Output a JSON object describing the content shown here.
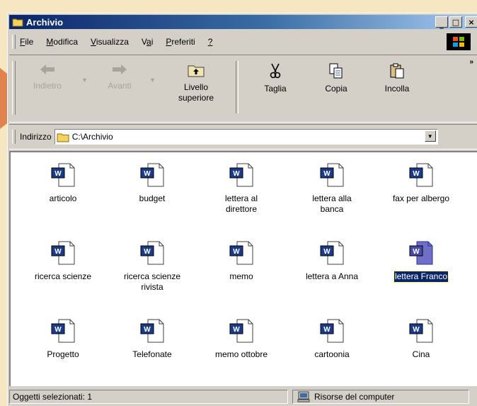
{
  "window": {
    "title": "Archivio"
  },
  "menu": [
    {
      "id": "file",
      "label": "File",
      "u": "F",
      "rest": "ile"
    },
    {
      "id": "modifica",
      "label": "Modifica",
      "u": "M",
      "rest": "odifica"
    },
    {
      "id": "visualizza",
      "label": "Visualizza",
      "u": "V",
      "rest": "isualizza"
    },
    {
      "id": "vai",
      "label": "Vai",
      "pre": "V",
      "u": "a",
      "rest": "i"
    },
    {
      "id": "preferiti",
      "label": "Preferiti",
      "u": "P",
      "rest": "referiti"
    },
    {
      "id": "help",
      "label": "?",
      "u": "?",
      "rest": ""
    }
  ],
  "toolbar": {
    "back_label": "Indietro",
    "forward_label": "Avanti",
    "up_label_1": "Livello",
    "up_label_2": "superiore",
    "cut_label": "Taglia",
    "copy_label": "Copia",
    "paste_label": "Incolla",
    "more": "»"
  },
  "address": {
    "label": "Indirizzo",
    "value": "C:\\Archivio"
  },
  "files": [
    {
      "l1": "articolo",
      "l2": ""
    },
    {
      "l1": "budget",
      "l2": ""
    },
    {
      "l1": "lettera al",
      "l2": "direttore"
    },
    {
      "l1": "lettera alla",
      "l2": "banca"
    },
    {
      "l1": "fax per albergo",
      "l2": ""
    },
    {
      "l1": "ricerca scienze",
      "l2": ""
    },
    {
      "l1": "ricerca scienze",
      "l2": "rivista"
    },
    {
      "l1": "memo",
      "l2": ""
    },
    {
      "l1": "lettera a Anna",
      "l2": ""
    },
    {
      "l1": "lettera Franco",
      "l2": "",
      "selected": true
    },
    {
      "l1": "Progetto",
      "l2": ""
    },
    {
      "l1": "Telefonate",
      "l2": ""
    },
    {
      "l1": "memo ottobre",
      "l2": ""
    },
    {
      "l1": "cartoonia",
      "l2": ""
    },
    {
      "l1": "Cina",
      "l2": ""
    }
  ],
  "status": {
    "left": "Oggetti selezionati: 1",
    "right": "Risorse del computer"
  },
  "colors": {
    "titlebar_start": "#0a246a",
    "selection": "#0a246a",
    "pointer": "#e0834d"
  }
}
